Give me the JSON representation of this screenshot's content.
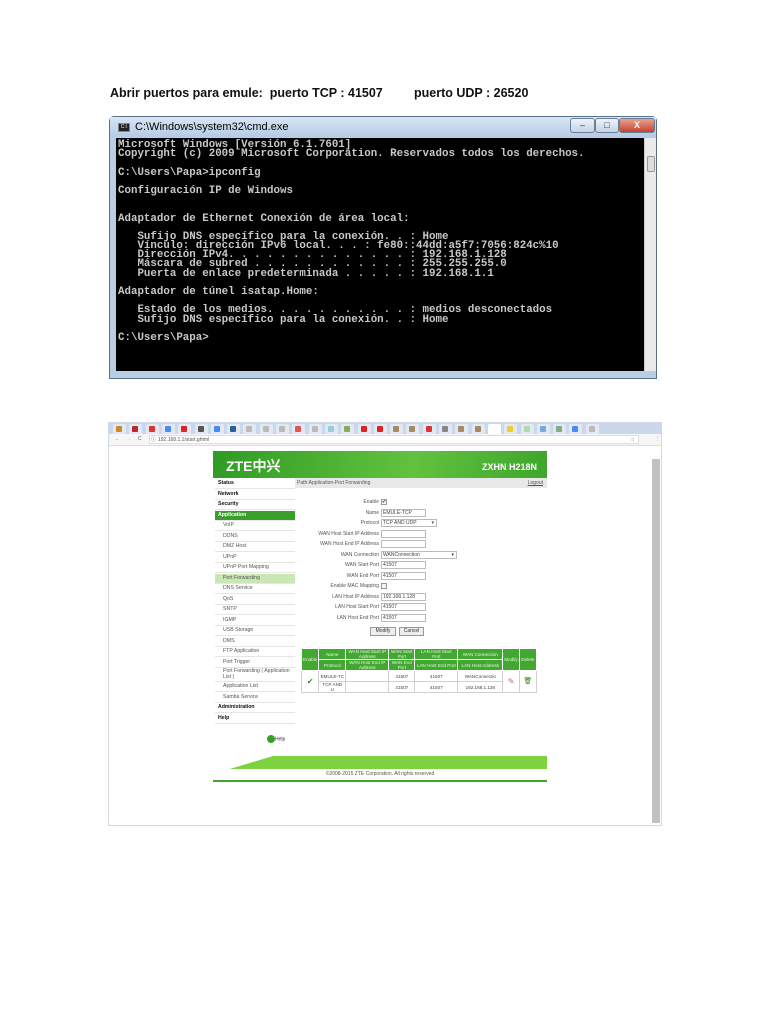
{
  "document": {
    "title": "Abrir puertos para emule:  puerto TCP : 41507         puerto UDP : 26520"
  },
  "cmd": {
    "title": "C:\\Windows\\system32\\cmd.exe",
    "icon_label": "C:\\",
    "buttons": {
      "minimize": "–",
      "maximize": "□",
      "close": "X"
    },
    "lines": [
      "Microsoft Windows [Versión 6.1.7601]",
      "Copyright (c) 2009 Microsoft Corporation. Reservados todos los derechos.",
      "",
      "C:\\Users\\Papa>ipconfig",
      "",
      "Configuración IP de Windows",
      "",
      "",
      "Adaptador de Ethernet Conexión de área local:",
      "",
      "   Sufijo DNS específico para la conexión. . : Home",
      "   Vínculo: dirección IPv6 local. . . : fe80::44dd:a5f7:7056:824c%10",
      "   Dirección IPv4. . . . . . . . . . . . . . : 192.168.1.128",
      "   Máscara de subred . . . . . . . . . . . . : 255.255.255.0",
      "   Puerta de enlace predeterminada . . . . . : 192.168.1.1",
      "",
      "Adaptador de túnel isatap.Home:",
      "",
      "   Estado de los medios. . . . . . . . . . . : medios desconectados",
      "   Sufijo DNS específico para la conexión. . : Home",
      "",
      "C:\\Users\\Papa>"
    ]
  },
  "browser": {
    "url": "192.168.1.1/start.ghtml",
    "nav": {
      "back": "←",
      "forward": "→",
      "reload": "C",
      "info": "ⓘ",
      "star": "☆",
      "menu": "⋮"
    },
    "tab_colors": [
      "#c98a2a",
      "#c0272d",
      "#d33",
      "#4a8af4",
      "#d22",
      "#555",
      "#4a8af4",
      "#2a5fa0",
      "#bbb",
      "#bbb",
      "#bbb",
      "#d55",
      "#bbb",
      "#9cd",
      "#8a5",
      "#d22",
      "#d22",
      "#a86",
      "#a86",
      "#d33",
      "#888",
      "#a86",
      "#a86",
      "#fff",
      "#ec3",
      "#ada",
      "#7ad",
      "#8a8",
      "#4a8af4",
      "#bbb"
    ]
  },
  "router": {
    "logo": "ZTE中兴",
    "model": "ZXHN H218N",
    "path": "Path:Application-Port Forwarding",
    "logout": "Logout",
    "sidebar": [
      {
        "label": "Status",
        "type": "top"
      },
      {
        "label": "Network",
        "type": "top"
      },
      {
        "label": "Security",
        "type": "top"
      },
      {
        "label": "Application",
        "type": "sel"
      },
      {
        "label": "VoIP",
        "type": "sub"
      },
      {
        "label": "DDNS",
        "type": "sub"
      },
      {
        "label": "DMZ Host",
        "type": "sub"
      },
      {
        "label": "UPnP",
        "type": "sub"
      },
      {
        "label": "UPnP Port Mapping",
        "type": "sub"
      },
      {
        "label": "Port Forwarding",
        "type": "cur"
      },
      {
        "label": "DNS Service",
        "type": "sub"
      },
      {
        "label": "QoS",
        "type": "sub"
      },
      {
        "label": "SNTP",
        "type": "sub"
      },
      {
        "label": "IGMP",
        "type": "sub"
      },
      {
        "label": "USB Storage",
        "type": "sub"
      },
      {
        "label": "DMS",
        "type": "sub"
      },
      {
        "label": "FTP Application",
        "type": "sub"
      },
      {
        "label": "Port Trigger",
        "type": "sub"
      },
      {
        "label": "Port Forwarding ( Application List )",
        "type": "sub2"
      },
      {
        "label": "Application List",
        "type": "sub"
      },
      {
        "label": "Samba Service",
        "type": "sub"
      },
      {
        "label": "Administration",
        "type": "top"
      },
      {
        "label": "Help",
        "type": "top"
      }
    ],
    "help": "Help",
    "form": [
      {
        "label": "Enable",
        "kind": "check",
        "value": "✔"
      },
      {
        "label": "Name",
        "kind": "text",
        "value": "EMULE-TCP"
      },
      {
        "label": "Protocol",
        "kind": "select",
        "value": "TCP AND UDP"
      },
      {
        "label": "WAN Host Start IP Address",
        "kind": "text",
        "value": ""
      },
      {
        "label": "WAN Host End IP Address",
        "kind": "text",
        "value": ""
      },
      {
        "label": "WAN Connection",
        "kind": "selectwide",
        "value": "WANConnection"
      },
      {
        "label": "WAN Start Port",
        "kind": "text",
        "value": "41507"
      },
      {
        "label": "WAN End Port",
        "kind": "text",
        "value": "41507"
      },
      {
        "label": "Enable MAC Mapping",
        "kind": "check",
        "value": ""
      },
      {
        "label": "LAN Host IP Address",
        "kind": "text",
        "value": "192.168.1.128"
      },
      {
        "label": "LAN Host Start Port",
        "kind": "text",
        "value": "41507"
      },
      {
        "label": "LAN Host End Port",
        "kind": "text",
        "value": "41507"
      }
    ],
    "modify": "Modify",
    "cancel": "Cancel",
    "table": {
      "header1": [
        "Enable",
        "Name",
        "WAN Host Start IP Address",
        "WAN Start Port",
        "LAN Host Start Port",
        "WAN Connection",
        "Modify",
        "Delete"
      ],
      "header2": [
        "Protocol",
        "WAN Host End IP Address",
        "WAN End Port",
        "LAN Host End Port",
        "LAN Host Address"
      ],
      "row1": [
        "EMULE-TC",
        "",
        "41507",
        "41507",
        "WANConnectio"
      ],
      "row2": [
        "TCP AND U",
        "",
        "41507",
        "41507",
        "192.168.1.128"
      ],
      "enabled": "✔",
      "modify_icon": "✎",
      "delete_icon": "🗑"
    },
    "copyright": "©2008-2015 ZTE Corporation. All rights reserved"
  }
}
